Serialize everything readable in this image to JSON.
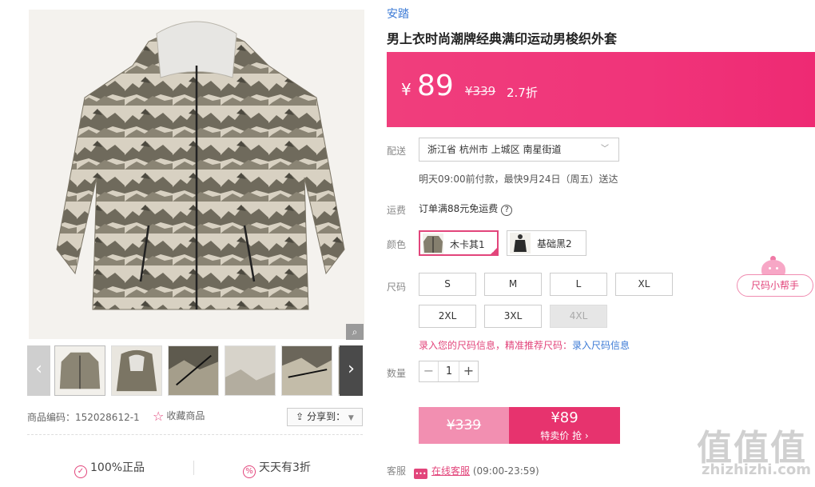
{
  "gallery": {
    "zoom_icon": "magnifier-icon",
    "thumbnails": 6
  },
  "meta": {
    "product_code": "商品编码：152028612-1",
    "favorite_label": "收藏商品",
    "share_label": "分享到："
  },
  "guarantees": {
    "genuine": "100%正品",
    "discount": "天天有3折"
  },
  "product": {
    "brand": "安踏",
    "title": "男上衣时尚潮牌经典满印运动男梭织外套",
    "price_symbol": "¥",
    "price": "89",
    "original_price": "¥339",
    "discount": "2.7折"
  },
  "delivery": {
    "label": "配送",
    "address": "浙江省 杭州市 上城区 南星街道",
    "note": "明天09:00前付款，最快9月24日（周五）送达"
  },
  "shipping": {
    "label": "运费",
    "text": "订单满88元免运费"
  },
  "color": {
    "label": "颜色",
    "options": [
      {
        "name": "木卡其1",
        "selected": true
      },
      {
        "name": "基础黑2",
        "selected": false
      }
    ]
  },
  "size": {
    "label": "尺码",
    "options": [
      "S",
      "M",
      "L",
      "XL",
      "2XL",
      "3XL",
      "4XL"
    ],
    "helper": "尺码小帮手",
    "tip": "录入您的尺码信息，精准推荐尺码：",
    "tip_link": "录入尺码信息"
  },
  "quantity": {
    "label": "数量",
    "value": "1"
  },
  "buy": {
    "original": "¥339",
    "price": "¥89",
    "label": "特卖价 抢 ›"
  },
  "service": {
    "label": "客服",
    "link": "在线客服",
    "hours": "(09:00-23:59)"
  },
  "watermark": {
    "big": "值值值",
    "small": "zhizhizhi.com"
  },
  "colors": {
    "accent": "#e2457b",
    "price_bar": "#f03e7c",
    "link": "#3d7bd6"
  }
}
